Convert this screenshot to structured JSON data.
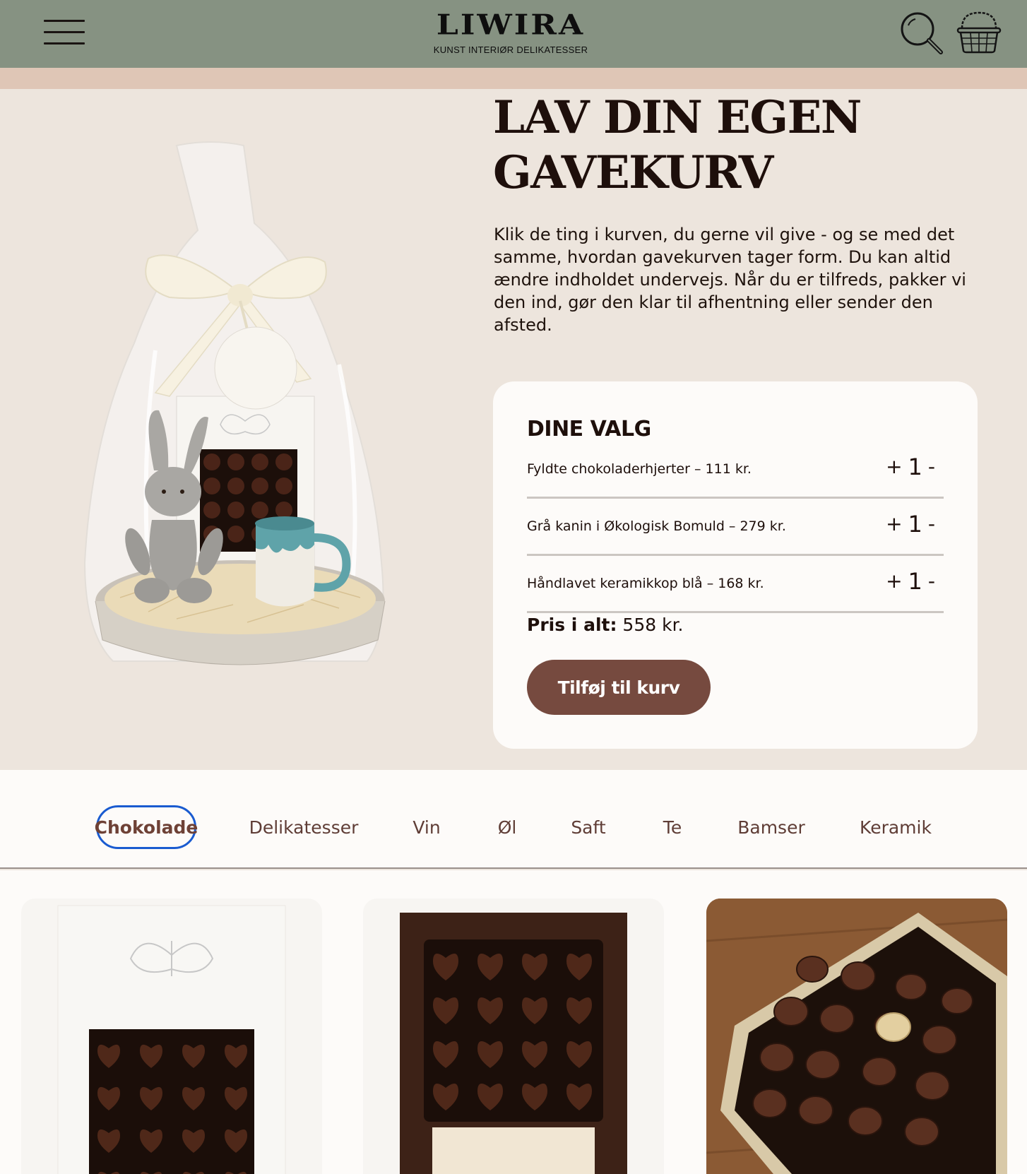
{
  "brand": {
    "name": "LIWIRA",
    "tagline": "KUNST INTERIØR DELIKATESSER"
  },
  "hero": {
    "title_line1": "LAV DIN EGEN",
    "title_line2": "GAVEKURV",
    "description": "Klik de ting i kurven, du gerne vil give - og se med det samme, hvordan gavekurven tager form. Du kan altid ændre indholdet undervejs. Når du er tilfreds, pakker vi den ind, gør den klar til afhentning eller sender den afsted."
  },
  "selection": {
    "title": "DINE VALG",
    "items": [
      {
        "label": "Fyldte chokoladerhjerter – 111 kr.",
        "qty": "1",
        "plus": "+",
        "minus": "-"
      },
      {
        "label": "Grå kanin i Økologisk Bomuld – 279 kr.",
        "qty": "1",
        "plus": "+",
        "minus": "-"
      },
      {
        "label": "Håndlavet keramikkop blå – 168 kr.",
        "qty": "1",
        "plus": "+",
        "minus": "-"
      }
    ],
    "total_label": "Pris i alt:",
    "total_value": "558 kr.",
    "add_button": "Tilføj til kurv"
  },
  "categories": [
    {
      "label": "Chokolade",
      "active": true
    },
    {
      "label": "Delikatesser",
      "active": false
    },
    {
      "label": "Vin",
      "active": false
    },
    {
      "label": "Øl",
      "active": false
    },
    {
      "label": "Saft",
      "active": false
    },
    {
      "label": "Te",
      "active": false
    },
    {
      "label": "Bamser",
      "active": false
    },
    {
      "label": "Keramik",
      "active": false
    }
  ],
  "icons": {
    "menu": "hamburger-menu-icon",
    "search": "search-icon",
    "basket": "basket-icon"
  },
  "colors": {
    "header_bg": "#869282",
    "accent_strip": "#dfc6b6",
    "page_bg": "#ede5dd",
    "panel_bg": "#fdfbf9",
    "button_bg": "#764a3f",
    "tab_text": "#5f3d36",
    "focus_ring": "#1a5bd0"
  }
}
